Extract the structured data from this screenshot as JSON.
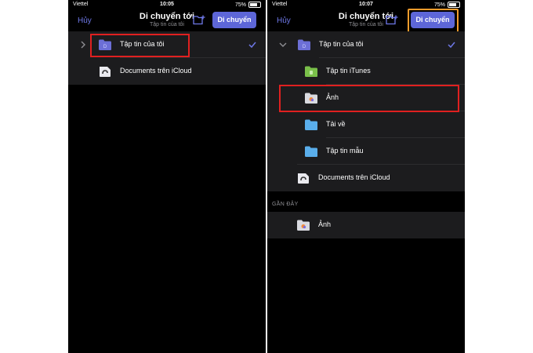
{
  "colors": {
    "accent": "#5d66d8",
    "highlight_red": "#e02020",
    "highlight_orange": "#f39c2c"
  },
  "left": {
    "status": {
      "carrier": "Viettel",
      "time": "10:05",
      "battery": "75%"
    },
    "nav": {
      "cancel": "Hủy",
      "title": "Di chuyển tới",
      "subtitle": "Tập tin của tôi",
      "move_button": "Di chuyển"
    },
    "rows": [
      {
        "label": "Tập tin của tôi",
        "icon": "purple-folder-icon",
        "expanded": false,
        "checked": true
      },
      {
        "label": "Documents trên iCloud",
        "icon": "icloud-drive-icon"
      }
    ]
  },
  "right": {
    "status": {
      "carrier": "Viettel",
      "time": "10:07",
      "battery": "75%"
    },
    "nav": {
      "cancel": "Hủy",
      "title": "Di chuyển tới",
      "subtitle": "Tập tin của tôi",
      "move_button": "Di chuyển"
    },
    "rows": [
      {
        "label": "Tập tin của tôi",
        "icon": "purple-folder-icon",
        "expanded": true,
        "checked": true
      },
      {
        "label": "Tập tin iTunes",
        "icon": "green-folder-icon"
      },
      {
        "label": "Ảnh",
        "icon": "photos-folder-icon"
      },
      {
        "label": "Tải về",
        "icon": "blue-folder-icon"
      },
      {
        "label": "Tập tin mẫu",
        "icon": "blue-folder-icon"
      },
      {
        "label": "Documents trên iCloud",
        "icon": "icloud-drive-icon"
      }
    ],
    "recent_header": "GẦN ĐÂY",
    "recent": [
      {
        "label": "Ảnh",
        "icon": "photos-folder-icon"
      }
    ]
  }
}
